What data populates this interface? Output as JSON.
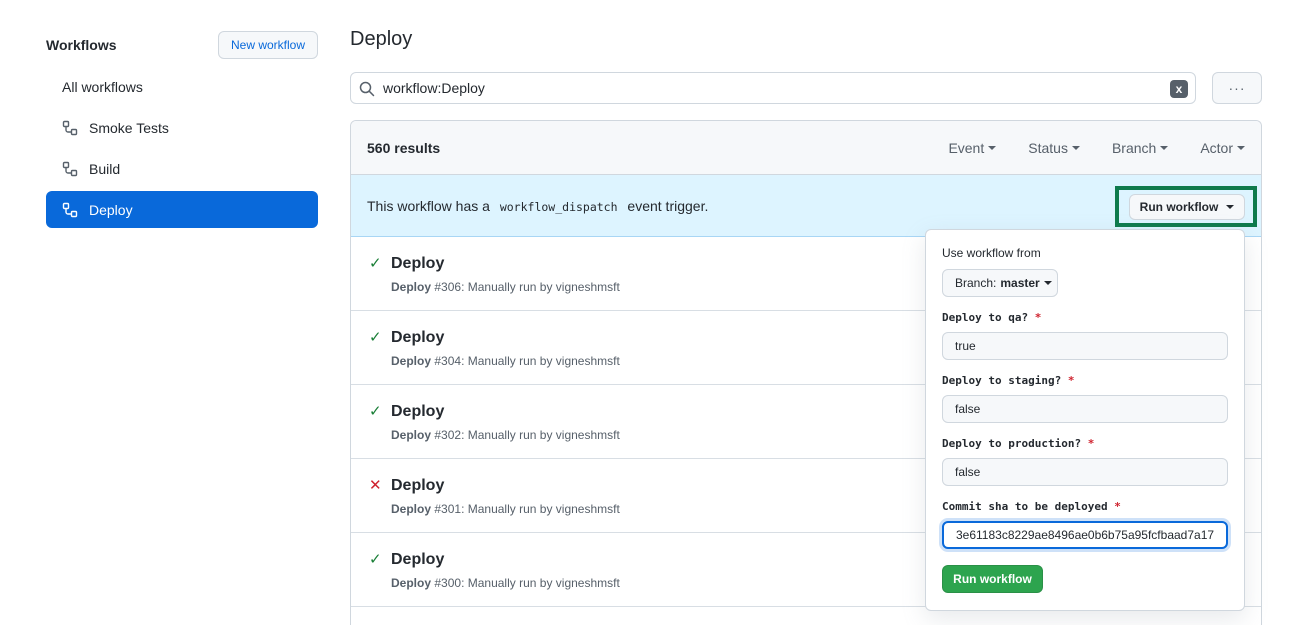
{
  "sidebar": {
    "title": "Workflows",
    "new_workflow": "New workflow",
    "items": [
      {
        "label": "All workflows"
      },
      {
        "label": "Smoke Tests"
      },
      {
        "label": "Build"
      },
      {
        "label": "Deploy"
      }
    ]
  },
  "main": {
    "title": "Deploy",
    "search": {
      "value": "workflow:Deploy",
      "clear_icon": "x",
      "more_icon": "···"
    },
    "results": "560 results",
    "filters": [
      "Event",
      "Status",
      "Branch",
      "Actor"
    ],
    "dispatch": {
      "text_before": "This workflow has a",
      "code": "workflow_dispatch",
      "text_after": "event trigger.",
      "run_button": "Run workflow"
    },
    "runs": [
      {
        "status": "success",
        "title": "Deploy",
        "workflow": "Deploy",
        "number": "#306",
        "detail": ": Manually run by vigneshmsft"
      },
      {
        "status": "success",
        "title": "Deploy",
        "workflow": "Deploy",
        "number": "#304",
        "detail": ": Manually run by vigneshmsft"
      },
      {
        "status": "success",
        "title": "Deploy",
        "workflow": "Deploy",
        "number": "#302",
        "detail": ": Manually run by vigneshmsft"
      },
      {
        "status": "failure",
        "title": "Deploy",
        "workflow": "Deploy",
        "number": "#301",
        "detail": ": Manually run by vigneshmsft"
      },
      {
        "status": "success",
        "title": "Deploy",
        "workflow": "Deploy",
        "number": "#300",
        "detail": ": Manually run by vigneshmsft"
      }
    ]
  },
  "dropdown": {
    "use_from": "Use workflow from",
    "branch_prefix": "Branch:",
    "branch": "master",
    "fields": [
      {
        "label": "Deploy to qa?",
        "value": "true"
      },
      {
        "label": "Deploy to staging?",
        "value": "false"
      },
      {
        "label": "Deploy to production?",
        "value": "false"
      },
      {
        "label": "Commit sha to be deployed",
        "value": "3e61183c8229ae8496ae0b6b75a95fcfbaad7a17"
      }
    ],
    "required_mark": "*",
    "submit": "Run workflow"
  },
  "colors": {
    "accent": "#0969da",
    "success": "#1a7f37",
    "danger": "#cf222e",
    "highlight_outline": "#0e7a4c",
    "primary_button": "#2da44e"
  },
  "icons": {
    "search": "search-icon",
    "workflow": "workflow-icon",
    "check": "check-icon",
    "cross": "x-icon",
    "caret": "triangle-down-icon"
  }
}
